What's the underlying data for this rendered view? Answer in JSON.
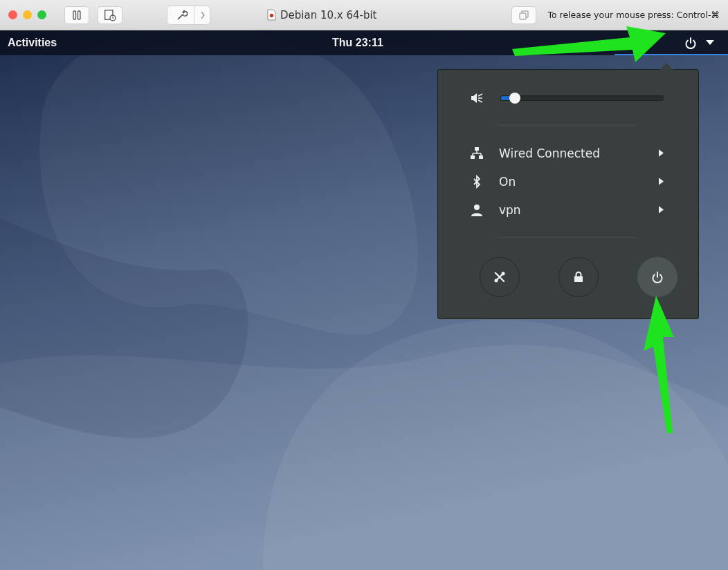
{
  "host_window": {
    "title": "Debian 10.x 64-bit",
    "release_hint": "To release your mouse press: Control-⌘"
  },
  "top_bar": {
    "activities": "Activities",
    "clock": "Thu 23:11"
  },
  "system_menu": {
    "volume": {
      "muted": true,
      "level": 0.06
    },
    "items": [
      {
        "kind": "network",
        "label": "Wired Connected"
      },
      {
        "kind": "bluetooth",
        "label": "On"
      },
      {
        "kind": "vpn",
        "label": "vpn"
      }
    ],
    "actions": [
      {
        "kind": "settings",
        "selected": false
      },
      {
        "kind": "lock",
        "selected": false
      },
      {
        "kind": "power",
        "selected": true
      }
    ]
  }
}
